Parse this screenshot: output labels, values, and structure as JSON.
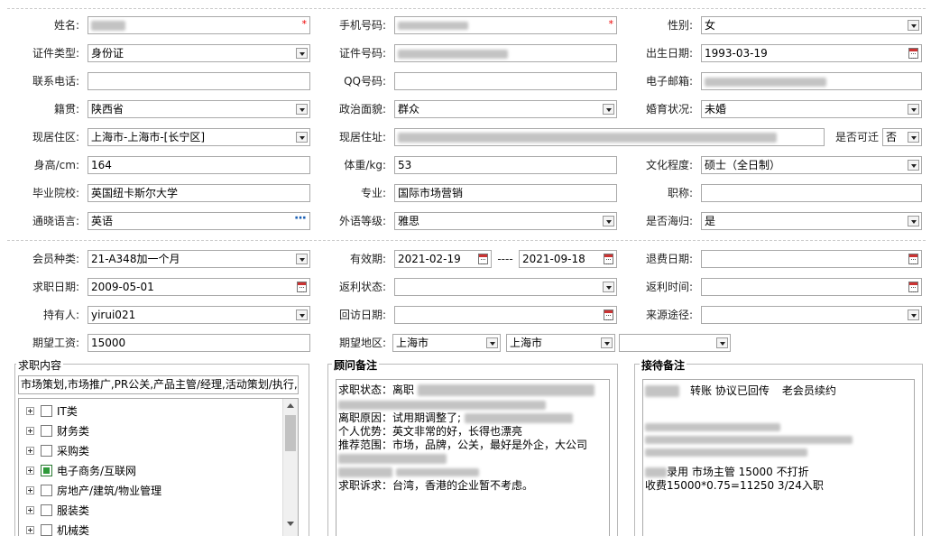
{
  "rows": {
    "name": {
      "label": "姓名:",
      "value": ""
    },
    "mobile": {
      "label": "手机号码:",
      "value": ""
    },
    "gender": {
      "label": "性别:",
      "value": "女"
    },
    "id_type": {
      "label": "证件类型:",
      "value": "身份证"
    },
    "id_number": {
      "label": "证件号码:",
      "value": ""
    },
    "birth_date": {
      "label": "出生日期:",
      "value": "1993-03-19"
    },
    "phone": {
      "label": "联系电话:",
      "value": ""
    },
    "qq": {
      "label": "QQ号码:",
      "value": ""
    },
    "email": {
      "label": "电子邮箱:",
      "value": ""
    },
    "native_place": {
      "label": "籍贯:",
      "value": "陕西省"
    },
    "political": {
      "label": "政治面貌:",
      "value": "群众"
    },
    "marital": {
      "label": "婚育状况:",
      "value": "未婚"
    },
    "residence_area": {
      "label": "现居住区:",
      "value": "上海市-上海市-[长宁区]"
    },
    "residence_addr": {
      "label": "现居住址:",
      "value": ""
    },
    "relocate": {
      "label": "是否可迁",
      "value": "否"
    },
    "height": {
      "label": "身高/cm:",
      "value": "164"
    },
    "weight": {
      "label": "体重/kg:",
      "value": "53"
    },
    "education": {
      "label": "文化程度:",
      "value": "硕士（全日制）"
    },
    "school": {
      "label": "毕业院校:",
      "value": "英国纽卡斯尔大学"
    },
    "major": {
      "label": "专业:",
      "value": "国际市场营销"
    },
    "title": {
      "label": "职称:",
      "value": ""
    },
    "language": {
      "label": "通晓语言:",
      "value": "英语"
    },
    "lang_level": {
      "label": "外语等级:",
      "value": "雅思"
    },
    "overseas": {
      "label": "是否海归:",
      "value": "是"
    },
    "member_type": {
      "label": "会员种类:",
      "value": "21-A348加一个月"
    },
    "validity": {
      "label": "有效期:",
      "from": "2021-02-19",
      "sep": "----",
      "to": "2021-09-18"
    },
    "refund_date": {
      "label": "退费日期:",
      "value": ""
    },
    "job_date": {
      "label": "求职日期:",
      "value": "2009-05-01"
    },
    "rebate_status": {
      "label": "返利状态:",
      "value": ""
    },
    "rebate_time": {
      "label": "返利时间:",
      "value": ""
    },
    "holder": {
      "label": "持有人:",
      "value": "yirui021"
    },
    "visit_date": {
      "label": "回访日期:",
      "value": ""
    },
    "source": {
      "label": "来源途径:",
      "value": ""
    },
    "salary": {
      "label": "期望工资:",
      "value": "15000"
    },
    "region": {
      "label": "期望地区:",
      "province": "上海市",
      "city": "上海市",
      "district": ""
    }
  },
  "job_panel": {
    "title": "求职内容",
    "summary": "市场策划,市场推广,PR公关,产品主管/经理,活动策划/执行,",
    "tree": [
      {
        "label": "IT类",
        "checked": false
      },
      {
        "label": "财务类",
        "checked": false
      },
      {
        "label": "采购类",
        "checked": false
      },
      {
        "label": "电子商务/互联网",
        "checked": true
      },
      {
        "label": "房地产/建筑/物业管理",
        "checked": false
      },
      {
        "label": "服装类",
        "checked": false
      },
      {
        "label": "机械类",
        "checked": false
      }
    ]
  },
  "advisor_panel": {
    "title": "顾问备注",
    "lines": [
      "求职状态：离职",
      "离职原因：试用期调整了;",
      "个人优势：英文非常的好，长得也漂亮",
      "推荐范围：市场，品牌，公关，最好是外企，大公司",
      "",
      "求职诉求：台湾，香港的企业暂不考虑。"
    ]
  },
  "reception_panel": {
    "title": "接待备注",
    "line1": "转账 协议已回传",
    "line1b": "老会员续约",
    "line2": "录用 市场主管 15000 不打折",
    "line3": "收费15000*0.75=11250 3/24入职"
  },
  "colors": {
    "required": "#e00000",
    "border": "#a9a9a9",
    "checked": "#2e9a3a",
    "dots": "#1a5fb4"
  }
}
